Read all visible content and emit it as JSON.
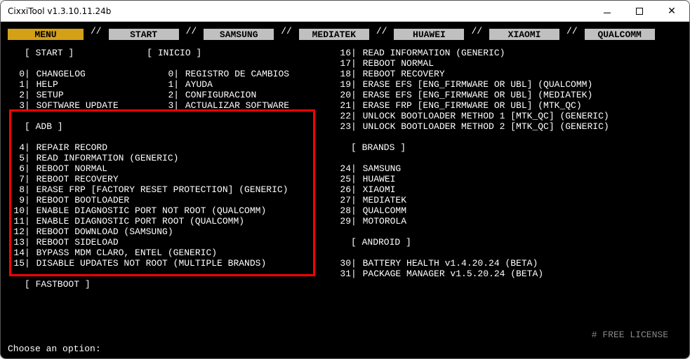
{
  "window": {
    "title": "CixxiTool v1.3.10.11.24b"
  },
  "tabs": {
    "menu": "MENU",
    "start": "START",
    "samsung": "SAMSUNG",
    "mediatek": "MEDIATEK",
    "huawei": "HUAWEI",
    "xiaomi": "XIAOMI",
    "qualcomm": "QUALCOMM",
    "sep": "//"
  },
  "sections": {
    "start": "[ START ]",
    "inicio": "[ INICIO ]",
    "adb": "[ ADB ]",
    "fastboot": "[ FASTBOOT ]",
    "brands": "[ BRANDS ]",
    "android": "[ ANDROID ]"
  },
  "left_start": [
    {
      "idx": "0",
      "txt": "CHANGELOG"
    },
    {
      "idx": "1",
      "txt": "HELP"
    },
    {
      "idx": "2",
      "txt": "SETUP"
    },
    {
      "idx": "3",
      "txt": "SOFTWARE UPDATE"
    }
  ],
  "inicio": [
    {
      "idx": "0",
      "txt": "REGISTRO DE CAMBIOS"
    },
    {
      "idx": "1",
      "txt": "AYUDA"
    },
    {
      "idx": "2",
      "txt": "CONFIGURACION"
    },
    {
      "idx": "3",
      "txt": "ACTUALIZAR SOFTWARE"
    }
  ],
  "adb": [
    {
      "idx": "4",
      "txt": "REPAIR RECORD"
    },
    {
      "idx": "5",
      "txt": "READ INFORMATION (GENERIC)"
    },
    {
      "idx": "6",
      "txt": "REBOOT NORMAL"
    },
    {
      "idx": "7",
      "txt": "REBOOT RECOVERY"
    },
    {
      "idx": "8",
      "txt": "ERASE FRP [FACTORY RESET PROTECTION] (GENERIC)"
    },
    {
      "idx": "9",
      "txt": "REBOOT BOOTLOADER"
    },
    {
      "idx": "10",
      "txt": "ENABLE DIAGNOSTIC PORT NOT ROOT (QUALCOMM)"
    },
    {
      "idx": "11",
      "txt": "ENABLE DIAGNOSTIC PORT ROOT (QUALCOMM)"
    },
    {
      "idx": "12",
      "txt": "REBOOT DOWNLOAD (SAMSUNG)"
    },
    {
      "idx": "13",
      "txt": "REBOOT SIDELOAD"
    },
    {
      "idx": "14",
      "txt": "BYPASS MDM CLARO, ENTEL (GENERIC)"
    },
    {
      "idx": "15",
      "txt": "DISABLE UPDATES NOT ROOT (MULTIPLE BRANDS)"
    }
  ],
  "right_top": [
    {
      "idx": "16",
      "txt": "READ INFORMATION (GENERIC)"
    },
    {
      "idx": "17",
      "txt": "REBOOT NORMAL"
    },
    {
      "idx": "18",
      "txt": "REBOOT RECOVERY"
    },
    {
      "idx": "19",
      "txt": "ERASE EFS [ENG_FIRMWARE OR UBL] (QUALCOMM)"
    },
    {
      "idx": "20",
      "txt": "ERASE EFS [ENG_FIRMWARE OR UBL] (MEDIATEK)"
    },
    {
      "idx": "21",
      "txt": "ERASE FRP [ENG_FIRMWARE OR UBL] (MTK_QC)"
    },
    {
      "idx": "22",
      "txt": "UNLOCK BOOTLOADER METHOD 1 [MTK_QC] (GENERIC)"
    },
    {
      "idx": "23",
      "txt": "UNLOCK BOOTLOADER METHOD 2 [MTK_QC] (GENERIC)"
    }
  ],
  "brands": [
    {
      "idx": "24",
      "txt": "SAMSUNG"
    },
    {
      "idx": "25",
      "txt": "HUAWEI"
    },
    {
      "idx": "26",
      "txt": "XIAOMI"
    },
    {
      "idx": "27",
      "txt": "MEDIATEK"
    },
    {
      "idx": "28",
      "txt": "QUALCOMM"
    },
    {
      "idx": "29",
      "txt": "MOTOROLA"
    }
  ],
  "android": [
    {
      "idx": "30",
      "txt": "BATTERY HEALTH v1.4.20.24 (BETA)"
    },
    {
      "idx": "31",
      "txt": "PACKAGE MANAGER v1.5.20.24 (BETA)"
    }
  ],
  "footer": {
    "license": "# FREE LICENSE",
    "prompt": "Choose an option:"
  }
}
